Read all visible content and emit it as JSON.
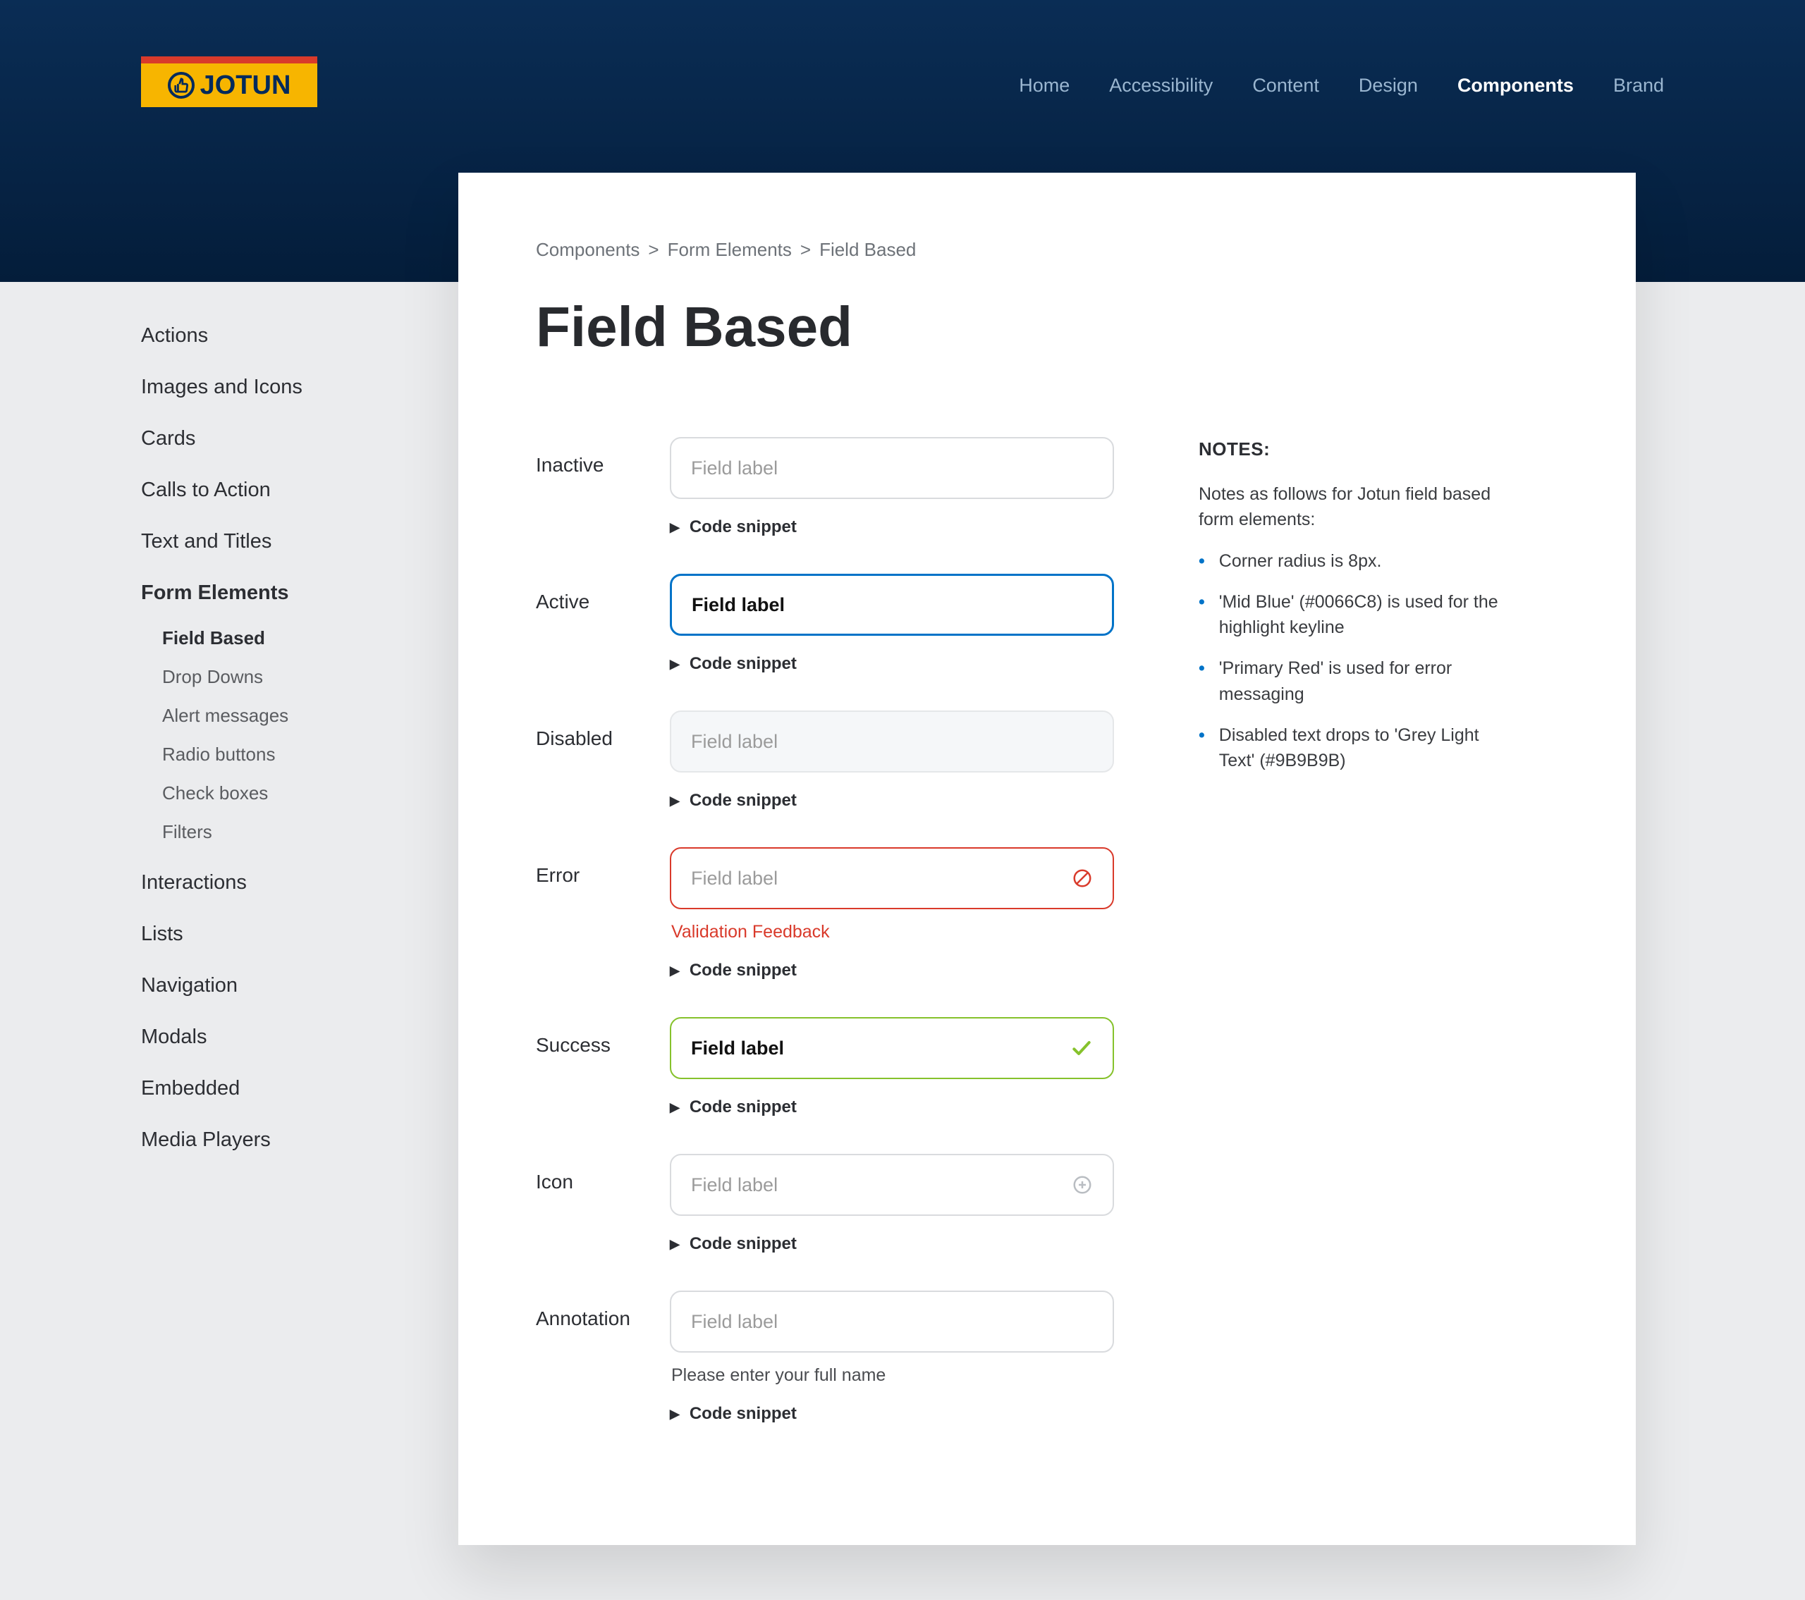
{
  "brand": {
    "name": "JOTUN"
  },
  "topnav": {
    "items": [
      {
        "label": "Home"
      },
      {
        "label": "Accessibility"
      },
      {
        "label": "Content"
      },
      {
        "label": "Design"
      },
      {
        "label": "Components",
        "active": true
      },
      {
        "label": "Brand"
      }
    ]
  },
  "breadcrumb": {
    "items": [
      "Components",
      "Form Elements",
      "Field Based"
    ]
  },
  "page": {
    "title": "Field Based"
  },
  "sidebar": {
    "items": [
      {
        "label": "Actions"
      },
      {
        "label": "Images and Icons"
      },
      {
        "label": "Cards"
      },
      {
        "label": "Calls to Action"
      },
      {
        "label": "Text and Titles"
      },
      {
        "label": "Form Elements",
        "current": true,
        "children": [
          {
            "label": "Field Based",
            "current": true
          },
          {
            "label": "Drop Downs"
          },
          {
            "label": "Alert messages"
          },
          {
            "label": "Radio buttons"
          },
          {
            "label": "Check boxes"
          },
          {
            "label": "Filters"
          }
        ]
      },
      {
        "label": "Interactions"
      },
      {
        "label": "Lists"
      },
      {
        "label": "Navigation"
      },
      {
        "label": "Modals"
      },
      {
        "label": "Embedded"
      },
      {
        "label": "Media Players"
      }
    ]
  },
  "specimens": {
    "code_snippet_label": "Code snippet",
    "rows": [
      {
        "state_label": "Inactive",
        "value": "",
        "placeholder": "Field label"
      },
      {
        "state_label": "Active",
        "value": "Field label",
        "placeholder": ""
      },
      {
        "state_label": "Disabled",
        "value": "",
        "placeholder": "Field label"
      },
      {
        "state_label": "Error",
        "value": "",
        "placeholder": "Field label",
        "validation": "Validation Feedback"
      },
      {
        "state_label": "Success",
        "value": "Field label",
        "placeholder": ""
      },
      {
        "state_label": "Icon",
        "value": "",
        "placeholder": "Field label"
      },
      {
        "state_label": "Annotation",
        "value": "",
        "placeholder": "Field label",
        "annotation": "Please enter your full name"
      }
    ]
  },
  "notes": {
    "title": "NOTES:",
    "intro": "Notes as follows for Jotun field based form elements:",
    "items": [
      "Corner radius is 8px.",
      "'Mid Blue' (#0066C8) is used for the highlight keyline",
      "'Primary Red' is used for error messaging",
      "Disabled text drops to 'Grey Light Text' (#9B9B9B)"
    ]
  }
}
